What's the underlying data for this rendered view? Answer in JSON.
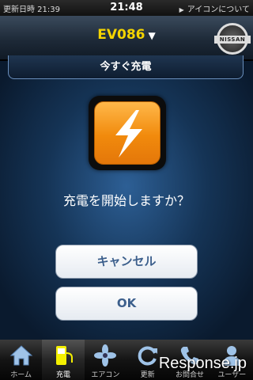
{
  "status_bar": {
    "left_text": "更新日時 21:39",
    "time": "21:48",
    "right_text": "アイコンについて"
  },
  "nav": {
    "vehicle": "EV086",
    "logo_text": "NISSAN"
  },
  "tab_strip": {
    "label": "今すぐ充電"
  },
  "dialog": {
    "prompt": "充電を開始しますか？",
    "cancel_label": "キャンセル",
    "ok_label": "OK"
  },
  "tabbar": {
    "items": [
      {
        "label": "ホーム",
        "icon": "home-icon"
      },
      {
        "label": "充電",
        "icon": "charge-plug-icon",
        "active": true
      },
      {
        "label": "エアコン",
        "icon": "fan-icon"
      },
      {
        "label": "更新",
        "icon": "refresh-icon"
      },
      {
        "label": "お問合せ",
        "icon": "phone-icon"
      },
      {
        "label": "ユーザー",
        "icon": "user-icon"
      }
    ]
  },
  "watermark": "Response.jp",
  "colors": {
    "accent_yellow": "#f4d400",
    "button_text": "#3c5f8c",
    "charge_orange": "#f18a0c"
  }
}
